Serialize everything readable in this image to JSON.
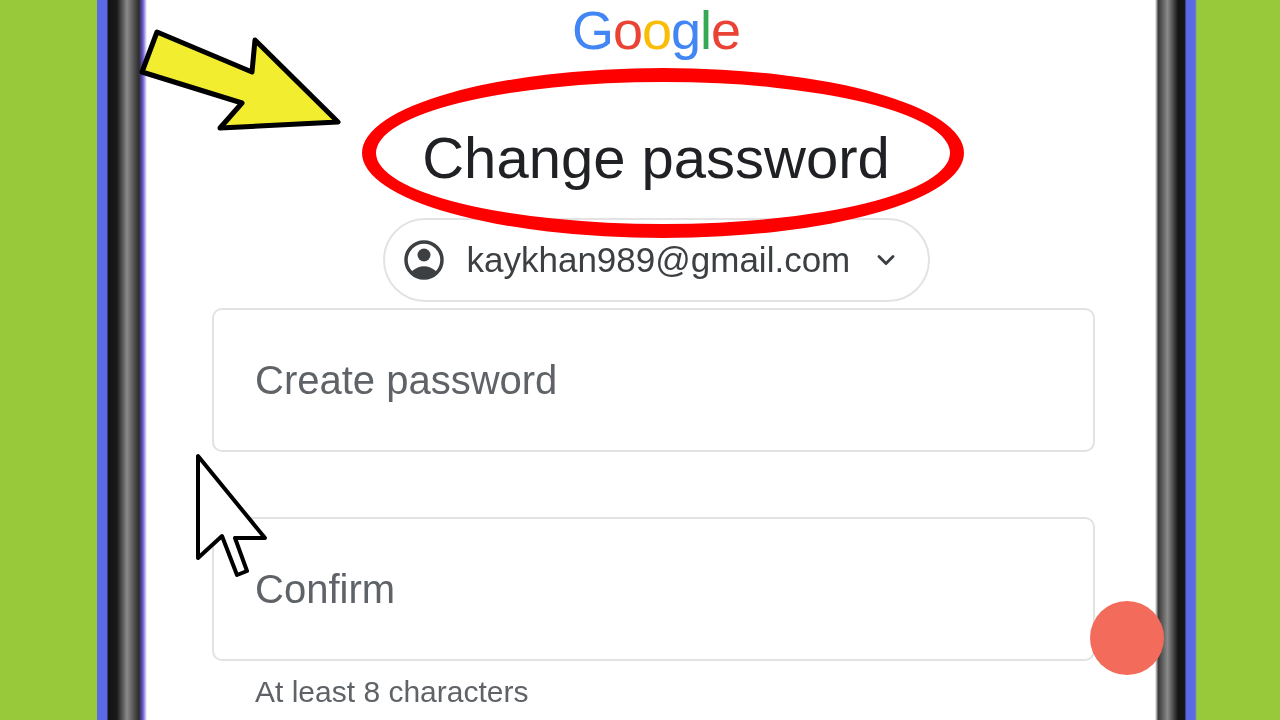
{
  "logo": {
    "text": "Google"
  },
  "heading": "Change password",
  "account": {
    "email": "kaykhan989@gmail.com"
  },
  "fields": [
    {
      "placeholder": "Create password"
    },
    {
      "placeholder": "Confirm"
    }
  ],
  "helper_text": "At least 8 characters"
}
